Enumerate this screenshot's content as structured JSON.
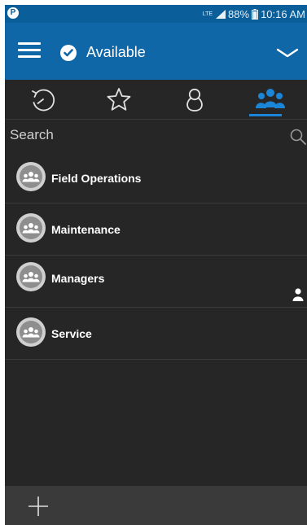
{
  "statusbar": {
    "network": "LTE",
    "battery": "88%",
    "time": "10:16 AM",
    "icons": [
      "app-p-icon",
      "signal-icon",
      "battery-icon"
    ]
  },
  "header": {
    "status_label": "Available",
    "icons": [
      "hamburger-menu-icon",
      "check-circle-icon",
      "chevron-down-icon"
    ]
  },
  "tabs": [
    {
      "icon": "history-icon",
      "active": false
    },
    {
      "icon": "star-icon",
      "active": false
    },
    {
      "icon": "contact-icon",
      "active": false
    },
    {
      "icon": "groups-icon",
      "active": true
    }
  ],
  "search": {
    "placeholder": "Search"
  },
  "groups": [
    {
      "name": "Field Operations",
      "has_member_indicator": false
    },
    {
      "name": "Maintenance",
      "has_member_indicator": false
    },
    {
      "name": "Managers",
      "has_member_indicator": true
    },
    {
      "name": "Service",
      "has_member_indicator": false
    }
  ],
  "footer": {
    "icons": [
      "add-icon"
    ]
  },
  "colors": {
    "header_blue": "#0f67a8",
    "status_blue": "#0a5e99",
    "accent_blue": "#1b86d8",
    "background": "#262626",
    "footer": "#3a3a3a"
  }
}
